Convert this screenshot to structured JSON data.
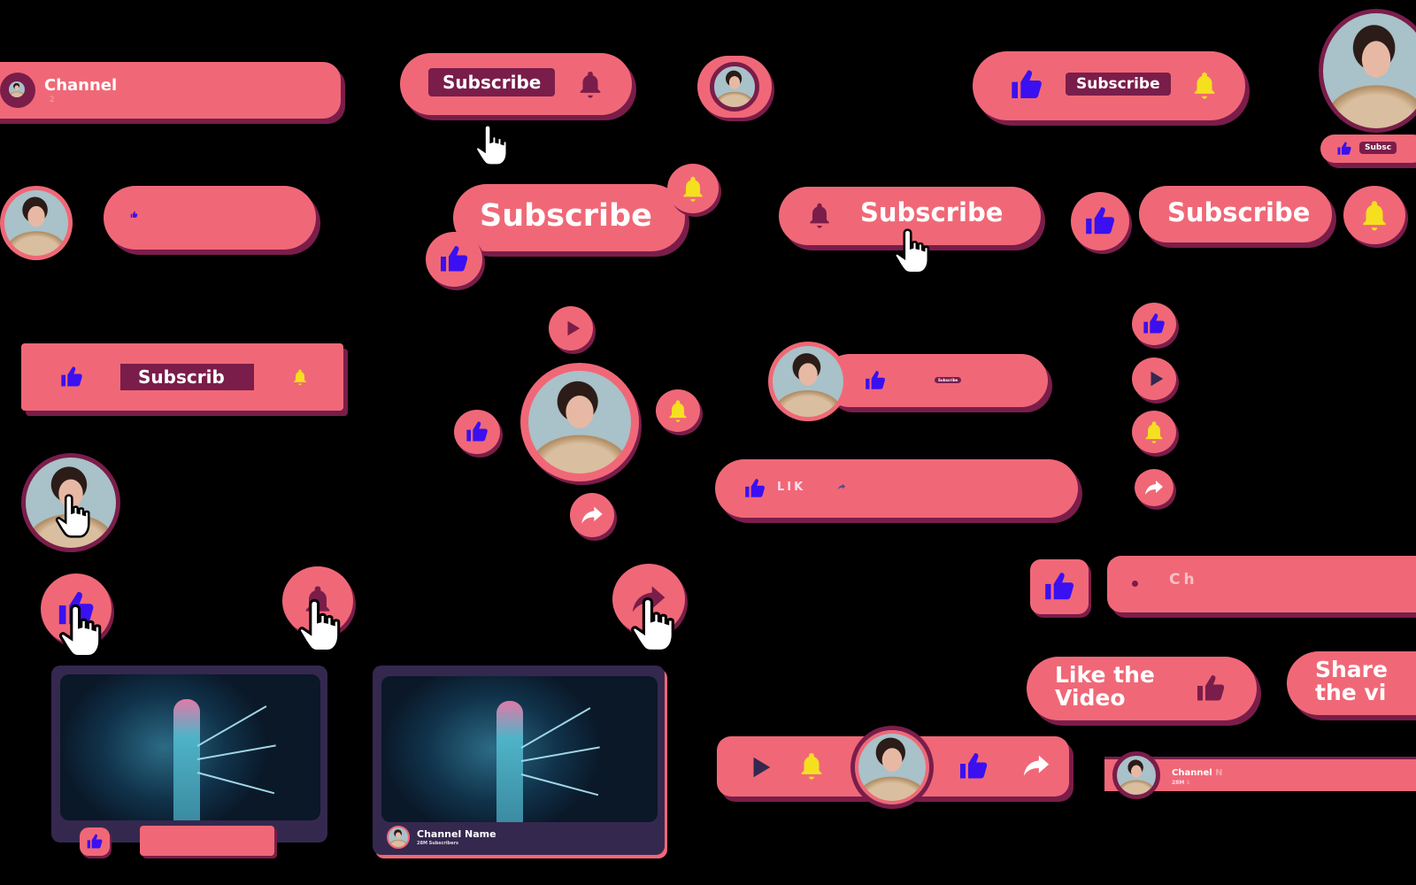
{
  "colors": {
    "pink": "#f06877",
    "maroon": "#7a1d4a",
    "thumb_blue": "#3a10f0",
    "bell_yellow": "#f5e020",
    "card_bg": "#35284f"
  },
  "channel_bar": {
    "name": "Channel",
    "subs": "2"
  },
  "subscribe": {
    "label": "Subscribe",
    "partial": "Subscrib",
    "tiny": "Subscribe",
    "cut": "Subsc"
  },
  "like_bar": {
    "label": "LIK"
  },
  "channel_partial": {
    "label": "Ch"
  },
  "like_video": {
    "label": "Like the\nVideo"
  },
  "share_video": {
    "label": "Share\nthe vi"
  },
  "channel_strip": {
    "name": "Channel",
    "name_fade": "N",
    "subs": "28M",
    "subs_fade": "S"
  },
  "video_card": {
    "channel": "Channel Name",
    "subs": "28M Subscribers"
  },
  "icons": [
    "thumbs-up-icon",
    "bell-icon",
    "play-icon",
    "share-icon",
    "hand-cursor-icon",
    "avatar"
  ]
}
